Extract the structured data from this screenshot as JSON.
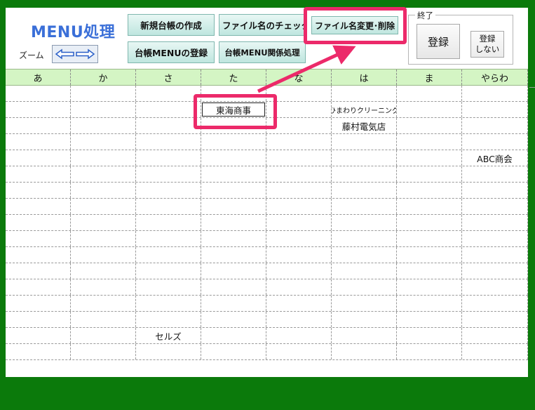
{
  "header": {
    "title": "MENU処理",
    "zoom_label": "ズーム"
  },
  "toolbar": {
    "new_ledger": "新規台帳の作成",
    "check_filename": "ファイル名のチェック",
    "rename_delete": "ファイル名変更･削除",
    "register_menu": "台帳MENUの登録",
    "menu_related": "台帳MENU関係処理"
  },
  "exit_group": {
    "label": "終了",
    "register": "登録",
    "no_register_line1": "登録",
    "no_register_line2": "しない"
  },
  "grid": {
    "columns": [
      "あ",
      "か",
      "さ",
      "た",
      "な",
      "は",
      "ま",
      "やらわ"
    ],
    "rows": [
      [
        "",
        "",
        "",
        "",
        "",
        "",
        "",
        ""
      ],
      [
        "",
        "",
        "",
        "東海商事",
        "",
        "ひまわりクリーニング",
        "",
        ""
      ],
      [
        "",
        "",
        "",
        "",
        "",
        "藤村電気店",
        "",
        ""
      ],
      [
        "",
        "",
        "",
        "",
        "",
        "",
        "",
        ""
      ],
      [
        "",
        "",
        "",
        "",
        "",
        "",
        "",
        "ABC商会"
      ],
      [
        "",
        "",
        "",
        "",
        "",
        "",
        "",
        ""
      ],
      [
        "",
        "",
        "",
        "",
        "",
        "",
        "",
        ""
      ],
      [
        "",
        "",
        "",
        "",
        "",
        "",
        "",
        ""
      ],
      [
        "",
        "",
        "",
        "",
        "",
        "",
        "",
        ""
      ],
      [
        "",
        "",
        "",
        "",
        "",
        "",
        "",
        ""
      ],
      [
        "",
        "",
        "",
        "",
        "",
        "",
        "",
        ""
      ],
      [
        "",
        "",
        "",
        "",
        "",
        "",
        "",
        ""
      ],
      [
        "",
        "",
        "",
        "",
        "",
        "",
        "",
        ""
      ],
      [
        "",
        "",
        "",
        "",
        "",
        "",
        "",
        ""
      ],
      [
        "",
        "",
        "",
        "",
        "",
        "",
        "",
        ""
      ],
      [
        "",
        "",
        "セルズ",
        "",
        "",
        "",
        "",
        ""
      ],
      [
        "",
        "",
        "",
        "",
        "",
        "",
        "",
        ""
      ]
    ]
  },
  "colors": {
    "frame": "#0b7a0b",
    "highlight": "#ec2a6a",
    "header_bg": "#d4f5c4",
    "title": "#3a6fd8"
  },
  "icons": {
    "zoom": "left-right-arrows-icon"
  }
}
